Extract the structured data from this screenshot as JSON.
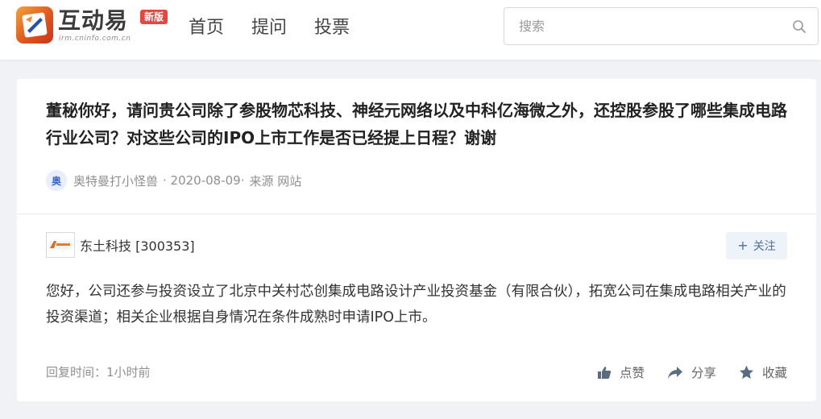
{
  "header": {
    "logo_text": "互动易",
    "logo_badge": "新版",
    "logo_domain": "irm.cninfo.com.cn",
    "nav": [
      "首页",
      "提问",
      "投票"
    ],
    "search_placeholder": "搜索"
  },
  "question": {
    "text": "董秘你好，请问贵公司除了参股物芯科技、神经元网络以及中科亿海微之外，还控股参股了哪些集成电路行业公司？对这些公司的IPO上市工作是否已经提上日程？谢谢",
    "avatar_char": "奥",
    "author": "奥特曼打小怪兽",
    "date": "· 2020-08-09·",
    "source": "来源 网站"
  },
  "answer": {
    "company": "东土科技 [300353]",
    "follow_plus": "+",
    "follow_label": "关注",
    "text": "您好，公司还参与投资设立了北京中关村芯创集成电路设计产业投资基金（有限合伙），拓宽公司在集成电路相关产业的投资渠道；相关企业根据自身情况在条件成熟时申请IPO上市。",
    "reply_time": "回复时间：1小时前",
    "like": "点赞",
    "share": "分享",
    "collect": "收藏"
  },
  "colors": {
    "accent": "#4a6fa5",
    "badge": "#e8453c",
    "logo_orange": "#e0571e"
  },
  "icons": [
    "logo-icon",
    "search-icon",
    "thumbs-up-icon",
    "share-icon",
    "star-icon",
    "company-logo"
  ]
}
